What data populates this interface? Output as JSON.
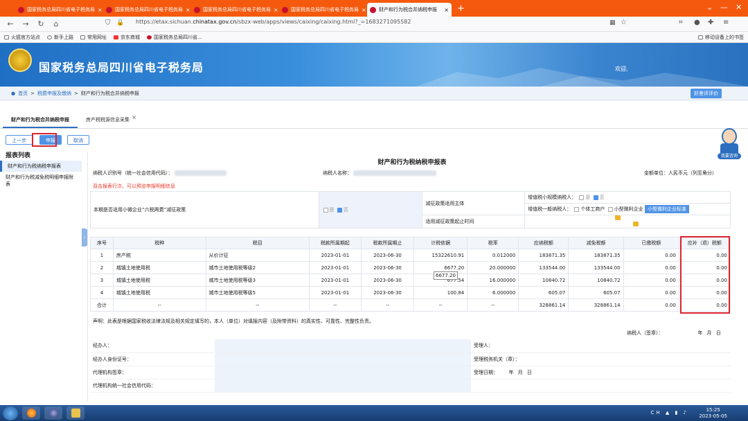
{
  "browser": {
    "tabs": [
      {
        "title": "国家税务总局四川省电子税务局",
        "active": false
      },
      {
        "title": "国家税务总局四川省电子税务局",
        "active": false
      },
      {
        "title": "国家税务总局四川省电子税务局",
        "active": false
      },
      {
        "title": "国家税务总局四川省电子税务局",
        "active": false
      },
      {
        "title": "财产和行为税合并纳税申报",
        "active": true
      }
    ],
    "url_prefix": "https://etax.sichuan.",
    "url_domain": "chinatax.gov.cn",
    "url_suffix": "/sbzx-web/apps/views/caixing/caixing.html?_=1683271095582",
    "bookmarks": [
      "火狐官方站点",
      "新手上路",
      "常用网址",
      "京东商城",
      "国家税务总局四川省..."
    ],
    "mobile_bookmarks": "移动设备上的书签"
  },
  "site": {
    "title": "国家税务总局四川省电子税务局",
    "welcome": "欢迎,"
  },
  "breadcrumb": {
    "home": "首页",
    "level1": "税费申报及缴纳",
    "current": "财产和行为税合并纳税申报",
    "rate_button": "好差评评价"
  },
  "page_tabs": [
    {
      "label": "财产和行为税合并纳税申报",
      "active": true
    },
    {
      "label": "房产税税源信息采集",
      "active": false
    }
  ],
  "actions": {
    "prev": "上一步",
    "submit": "申报",
    "cancel": "取消"
  },
  "report_list": {
    "title": "报表列表",
    "items": [
      "财产和行为税纳税申报表",
      "财产和行为税减免税明细申报附表"
    ]
  },
  "form": {
    "title": "财产和行为税纳税申报表",
    "taxpayer_id_label": "纳税人识别号（统一社会信用代码）：",
    "taxpayer_name_label": "纳税人名称：",
    "unit": "金额单位：人民币元（列至角分）",
    "hint": "双击报表行次，可以预览申报明细信息",
    "policy": {
      "label": "本期是否适用小微企业“六税两费”减征政策",
      "yes": "是",
      "no": "否",
      "subject_label": "减征政策适用主体",
      "vat_small_label": "增值税小规模纳税人：",
      "vat_general_label": "增值税一般纳税人：",
      "individual": "个体工商户",
      "small_micro": "小型微利企业",
      "small_micro_std": "小型微利企业标准",
      "start_time_label": "适用减征政策起止时间"
    },
    "table": {
      "headers": [
        "序号",
        "税种",
        "税目",
        "税款所属期起",
        "税款所属期止",
        "计税依据",
        "税率",
        "应纳税额",
        "减免税额",
        "已缴税额",
        "应补（退）税额"
      ],
      "rows": [
        [
          "1",
          "房产税",
          "从价计征",
          "2023-01-01",
          "2023-06-30",
          "15322610.91",
          "0.012000",
          "183871.35",
          "183871.35",
          "0.00",
          "0.00"
        ],
        [
          "2",
          "城镇土地使用税",
          "城市土地使用税等级2",
          "2023-01-01",
          "2023-06-30",
          "6677.20",
          "20.000000",
          "133544.00",
          "133544.00",
          "0.00",
          "0.00"
        ],
        [
          "3",
          "城镇土地使用税",
          "城市土地使用税等级3",
          "2023-01-01",
          "2023-06-30",
          "677.54",
          "16.000000",
          "10840.72",
          "10840.72",
          "0.00",
          "0.00"
        ],
        [
          "4",
          "城镇土地使用税",
          "城市土地使用税等级5",
          "2023-01-01",
          "2023-06-30",
          "100.84",
          "6.000000",
          "605.07",
          "605.07",
          "0.00",
          "0.00"
        ],
        [
          "合计",
          "--",
          "--",
          "--",
          "--",
          "--",
          "--",
          "328861.14",
          "328861.14",
          "0.00",
          "0.00"
        ]
      ],
      "tooltip": "6677.20"
    },
    "statement": "声明：此表是根据国家税收法律法规及相关规定填写的，本人（单位）对填报内容（及附带资料）的真实性、可靠性、完整性负责。",
    "taxpayer_sign": "纳税人（签章）：",
    "date_labels": "年  月  日",
    "bottom": {
      "agent": "经办人：",
      "agent_id": "经办人身份证号：",
      "agency_seal": "代理机构签章：",
      "agency_code": "代理机构统一社会信用代码：",
      "receiver": "受理人：",
      "receiver_org": "受理税务机关（章）：",
      "receive_date": "受理日期：",
      "date_labels": "年  月  日"
    }
  },
  "assistant": {
    "label": "我要咨询"
  },
  "taskbar": {
    "time": "15:25",
    "date": "2023-05-05",
    "lang": "CH"
  },
  "colors": {
    "brand_blue": "#2c6fbf",
    "browser_orange": "#f4590d",
    "highlight_red": "#d9232d"
  }
}
